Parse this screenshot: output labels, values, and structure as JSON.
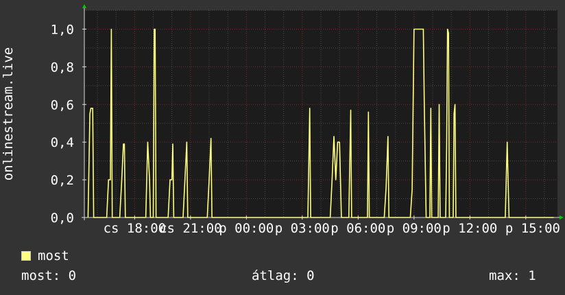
{
  "chart_data": {
    "type": "line",
    "ylabel": "onlinestream.live",
    "ylim": [
      0,
      1.1
    ],
    "y_ticks": [
      {
        "value": 0.0,
        "label": "0,0"
      },
      {
        "value": 0.2,
        "label": "0,2"
      },
      {
        "value": 0.4,
        "label": "0,4"
      },
      {
        "value": 0.6,
        "label": "0,6"
      },
      {
        "value": 0.8,
        "label": "0,8"
      },
      {
        "value": 1.0,
        "label": "1,0"
      }
    ],
    "xlim": [
      15.3,
      40.7
    ],
    "x_ticks": [
      {
        "value": 18,
        "label": "cs 18:00"
      },
      {
        "value": 21,
        "label": "cs 21:00"
      },
      {
        "value": 24,
        "label": "p 00:00"
      },
      {
        "value": 27,
        "label": "p 03:00"
      },
      {
        "value": 30,
        "label": "p 06:00"
      },
      {
        "value": 33,
        "label": "p 09:00"
      },
      {
        "value": 36,
        "label": "p 12:00"
      },
      {
        "value": 39,
        "label": "p 15:00"
      }
    ],
    "grid": true,
    "series": [
      {
        "name": "most",
        "color": "#ffff80",
        "points": [
          [
            15.5,
            0
          ],
          [
            15.6,
            0.55
          ],
          [
            15.65,
            0.58
          ],
          [
            15.75,
            0.58
          ],
          [
            15.8,
            0
          ],
          [
            16.5,
            0
          ],
          [
            16.6,
            0.2
          ],
          [
            16.7,
            0.2
          ],
          [
            16.75,
            1.0
          ],
          [
            16.8,
            0
          ],
          [
            17.2,
            0
          ],
          [
            17.3,
            0.18
          ],
          [
            17.4,
            0.39
          ],
          [
            17.45,
            0.39
          ],
          [
            17.5,
            0
          ],
          [
            18.6,
            0
          ],
          [
            18.7,
            0.4
          ],
          [
            18.8,
            0.2
          ],
          [
            18.85,
            0
          ],
          [
            19.0,
            0
          ],
          [
            19.05,
            1.0
          ],
          [
            19.1,
            1.0
          ],
          [
            19.15,
            0
          ],
          [
            19.8,
            0
          ],
          [
            19.9,
            0.2
          ],
          [
            20.0,
            0.2
          ],
          [
            20.05,
            0.39
          ],
          [
            20.1,
            0
          ],
          [
            20.6,
            0
          ],
          [
            20.7,
            0.2
          ],
          [
            20.8,
            0.4
          ],
          [
            20.85,
            0
          ],
          [
            21.9,
            0
          ],
          [
            22.0,
            0.2
          ],
          [
            22.1,
            0.42
          ],
          [
            22.15,
            0
          ],
          [
            27.3,
            0
          ],
          [
            27.4,
            0.58
          ],
          [
            27.45,
            0
          ],
          [
            28.5,
            0
          ],
          [
            28.6,
            0.2
          ],
          [
            28.7,
            0.43
          ],
          [
            28.8,
            0.2
          ],
          [
            28.9,
            0.4
          ],
          [
            29.0,
            0.4
          ],
          [
            29.1,
            0
          ],
          [
            29.5,
            0
          ],
          [
            29.6,
            0.57
          ],
          [
            29.65,
            0
          ],
          [
            30.5,
            0
          ],
          [
            30.55,
            0.56
          ],
          [
            30.6,
            0
          ],
          [
            31.4,
            0
          ],
          [
            31.5,
            0.16
          ],
          [
            31.6,
            0.43
          ],
          [
            31.65,
            0
          ],
          [
            32.8,
            0
          ],
          [
            32.9,
            0.15
          ],
          [
            33.0,
            1.0
          ],
          [
            33.5,
            1.0
          ],
          [
            33.55,
            0.6
          ],
          [
            33.65,
            0
          ],
          [
            33.85,
            0
          ],
          [
            33.9,
            0.58
          ],
          [
            33.95,
            0
          ],
          [
            34.3,
            0
          ],
          [
            34.35,
            0.6
          ],
          [
            34.4,
            0
          ],
          [
            34.7,
            0
          ],
          [
            34.75,
            0.38
          ],
          [
            34.8,
            1.0
          ],
          [
            34.85,
            0.98
          ],
          [
            34.9,
            0
          ],
          [
            35.1,
            0
          ],
          [
            35.15,
            0.55
          ],
          [
            35.2,
            0.6
          ],
          [
            35.25,
            0
          ],
          [
            37.9,
            0
          ],
          [
            38.0,
            0.4
          ],
          [
            38.05,
            0.2
          ],
          [
            38.1,
            0
          ],
          [
            40.5,
            0
          ]
        ]
      }
    ]
  },
  "legend": {
    "label": "most",
    "color": "#ffff80"
  },
  "stats": {
    "current": "most: 0",
    "average": "átlag: 0",
    "max": "max: 1"
  }
}
